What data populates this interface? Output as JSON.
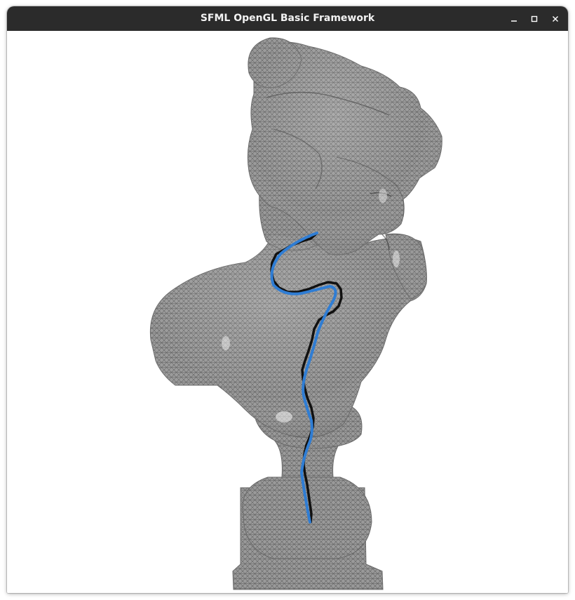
{
  "window": {
    "title": "SFML OpenGL Basic Framework"
  },
  "titlebar_buttons": {
    "minimize_icon": "minimize-icon",
    "maximize_icon": "maximize-icon",
    "close_icon": "close-icon"
  },
  "scene": {
    "background_color": "#ffffff",
    "mesh_color": "#8e8e8e",
    "wireframe_color": "#5a5a5a",
    "path_exact_color": "#111111",
    "path_approx_color": "#2f7dd4"
  }
}
